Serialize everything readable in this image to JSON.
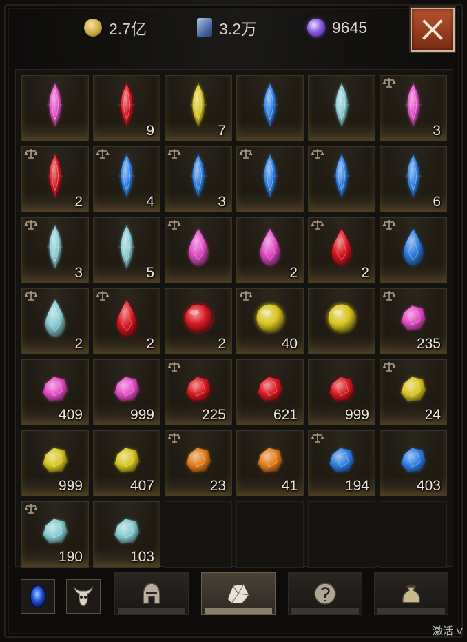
{
  "currency": {
    "gold": {
      "value": "2.7亿",
      "icon": "gold-coin-icon"
    },
    "scroll": {
      "value": "3.2万",
      "icon": "scroll-icon"
    },
    "orb": {
      "value": "9645",
      "icon": "purple-orb-icon"
    }
  },
  "close_icon": "close-x-icon",
  "colors": {
    "pink": "#e24cc4",
    "red": "#d8171f",
    "yellow": "#d8c420",
    "blue": "#2f7de0",
    "cyan": "#86c9d1",
    "orange": "#e07a1a",
    "close_button": "#a2462a"
  },
  "inventory": [
    {
      "type": "marquise",
      "color": "pink",
      "scale": false,
      "qty": ""
    },
    {
      "type": "marquise",
      "color": "red",
      "scale": false,
      "qty": "9"
    },
    {
      "type": "marquise",
      "color": "yellow",
      "scale": false,
      "qty": "7"
    },
    {
      "type": "marquise",
      "color": "blue",
      "scale": false,
      "qty": ""
    },
    {
      "type": "marquise",
      "color": "cyan",
      "scale": false,
      "qty": ""
    },
    {
      "type": "marquise",
      "color": "pink",
      "scale": true,
      "qty": "3"
    },
    {
      "type": "marquise",
      "color": "red",
      "scale": true,
      "qty": "2"
    },
    {
      "type": "marquise",
      "color": "blue",
      "scale": true,
      "qty": "4"
    },
    {
      "type": "marquise",
      "color": "blue",
      "scale": true,
      "qty": "3"
    },
    {
      "type": "marquise",
      "color": "blue",
      "scale": true,
      "qty": ""
    },
    {
      "type": "marquise",
      "color": "blue",
      "scale": true,
      "qty": ""
    },
    {
      "type": "marquise",
      "color": "blue",
      "scale": false,
      "qty": "6"
    },
    {
      "type": "marquise",
      "color": "cyan",
      "scale": true,
      "qty": "3"
    },
    {
      "type": "marquise",
      "color": "cyan",
      "scale": false,
      "qty": "5"
    },
    {
      "type": "teardrop",
      "color": "pink",
      "scale": true,
      "qty": ""
    },
    {
      "type": "teardrop",
      "color": "pink",
      "scale": false,
      "qty": "2"
    },
    {
      "type": "teardrop",
      "color": "red",
      "scale": true,
      "qty": "2"
    },
    {
      "type": "teardrop",
      "color": "blue",
      "scale": true,
      "qty": ""
    },
    {
      "type": "teardrop",
      "color": "cyan",
      "scale": true,
      "qty": "2"
    },
    {
      "type": "teardrop",
      "color": "red",
      "scale": true,
      "qty": "2"
    },
    {
      "type": "orb",
      "color": "red",
      "scale": false,
      "qty": "2"
    },
    {
      "type": "orb",
      "color": "yellow",
      "scale": true,
      "qty": "40"
    },
    {
      "type": "orb",
      "color": "yellow",
      "scale": false,
      "qty": ""
    },
    {
      "type": "rough",
      "color": "pink",
      "scale": true,
      "qty": "235"
    },
    {
      "type": "rough",
      "color": "pink",
      "scale": false,
      "qty": "409"
    },
    {
      "type": "rough",
      "color": "pink",
      "scale": false,
      "qty": "999"
    },
    {
      "type": "rough",
      "color": "red",
      "scale": true,
      "qty": "225"
    },
    {
      "type": "rough",
      "color": "red",
      "scale": false,
      "qty": "621"
    },
    {
      "type": "rough",
      "color": "red",
      "scale": false,
      "qty": "999"
    },
    {
      "type": "rough",
      "color": "yellow",
      "scale": true,
      "qty": "24"
    },
    {
      "type": "rough",
      "color": "yellow",
      "scale": false,
      "qty": "999"
    },
    {
      "type": "rough",
      "color": "yellow",
      "scale": false,
      "qty": "407"
    },
    {
      "type": "rough",
      "color": "orange",
      "scale": true,
      "qty": "23"
    },
    {
      "type": "rough",
      "color": "orange",
      "scale": false,
      "qty": "41"
    },
    {
      "type": "rough",
      "color": "blue",
      "scale": true,
      "qty": "194"
    },
    {
      "type": "rough",
      "color": "blue",
      "scale": false,
      "qty": "403"
    },
    {
      "type": "rough",
      "color": "cyan",
      "scale": true,
      "qty": "190"
    },
    {
      "type": "rough",
      "color": "cyan",
      "scale": false,
      "qty": "103"
    },
    {
      "type": "empty"
    },
    {
      "type": "empty"
    },
    {
      "type": "empty"
    },
    {
      "type": "empty"
    }
  ],
  "bottom_bar": {
    "buttons": [
      {
        "name": "soulstone-button",
        "icon": "blue-soulstone-icon"
      },
      {
        "name": "demon-button",
        "icon": "demon-head-icon"
      }
    ],
    "tabs": [
      {
        "name": "tab-armor",
        "icon": "helmet-icon",
        "active": false
      },
      {
        "name": "tab-gems",
        "icon": "gem-icon",
        "active": true
      },
      {
        "name": "tab-runes",
        "icon": "rune-icon",
        "active": false
      },
      {
        "name": "tab-bag",
        "icon": "bag-icon",
        "active": false
      }
    ]
  },
  "watermark": "激活 V"
}
